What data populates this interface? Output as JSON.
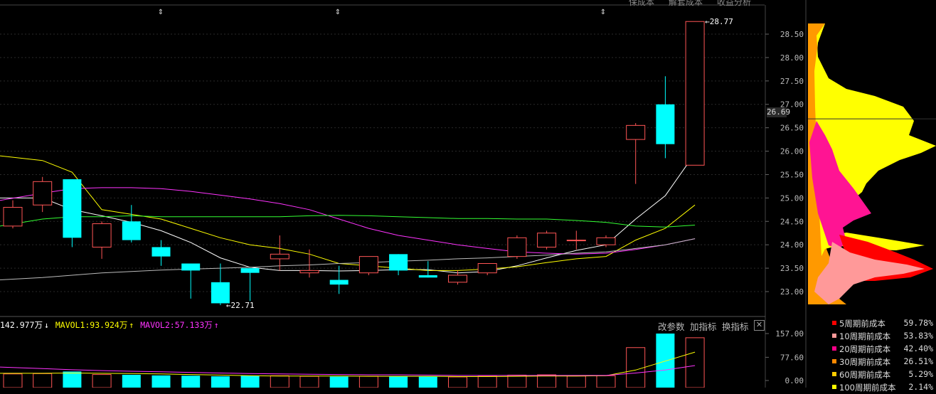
{
  "toolbar": {
    "buttons": [
      "保成本",
      "解套成本",
      "收益分析"
    ]
  },
  "chart_data": [
    {
      "type": "candlestick",
      "price_axis": {
        "ylim": [
          22.71,
          28.77
        ],
        "ticks": [
          "28.50",
          "28.00",
          "27.50",
          "27.00",
          "26.50",
          "26.00",
          "25.50",
          "25.00",
          "24.50",
          "24.00",
          "23.50",
          "23.00"
        ]
      },
      "current_price": "26.69",
      "annotations": {
        "high": "28.77",
        "low": "22.71"
      },
      "candles": [
        {
          "o": 24.4,
          "h": 24.95,
          "l": 24.35,
          "c": 24.8
        },
        {
          "o": 24.85,
          "h": 25.45,
          "l": 24.7,
          "c": 25.35
        },
        {
          "o": 25.4,
          "h": 25.4,
          "l": 23.95,
          "c": 24.15
        },
        {
          "o": 23.95,
          "h": 24.5,
          "l": 23.7,
          "c": 24.45
        },
        {
          "o": 24.5,
          "h": 24.85,
          "l": 24.05,
          "c": 24.1
        },
        {
          "o": 23.95,
          "h": 24.1,
          "l": 23.55,
          "c": 23.75
        },
        {
          "o": 23.6,
          "h": 23.6,
          "l": 22.85,
          "c": 23.45
        },
        {
          "o": 23.2,
          "h": 23.6,
          "l": 22.71,
          "c": 22.75
        },
        {
          "o": 23.5,
          "h": 23.5,
          "l": 22.8,
          "c": 23.4
        },
        {
          "o": 23.7,
          "h": 24.2,
          "l": 23.45,
          "c": 23.8
        },
        {
          "o": 23.4,
          "h": 23.9,
          "l": 23.3,
          "c": 23.45
        },
        {
          "o": 23.25,
          "h": 23.55,
          "l": 22.95,
          "c": 23.15
        },
        {
          "o": 23.4,
          "h": 23.75,
          "l": 23.35,
          "c": 23.75
        },
        {
          "o": 23.8,
          "h": 23.8,
          "l": 23.35,
          "c": 23.45
        },
        {
          "o": 23.35,
          "h": 23.65,
          "l": 23.3,
          "c": 23.3
        },
        {
          "o": 23.2,
          "h": 23.45,
          "l": 23.15,
          "c": 23.35
        },
        {
          "o": 23.4,
          "h": 23.6,
          "l": 23.35,
          "c": 23.6
        },
        {
          "o": 23.75,
          "h": 24.2,
          "l": 23.7,
          "c": 24.15
        },
        {
          "o": 23.95,
          "h": 24.3,
          "l": 23.9,
          "c": 24.25
        },
        {
          "o": 24.1,
          "h": 24.3,
          "l": 23.9,
          "c": 24.1
        },
        {
          "o": 24.0,
          "h": 24.2,
          "l": 23.95,
          "c": 24.15
        },
        {
          "o": 26.25,
          "h": 26.6,
          "l": 25.3,
          "c": 26.55
        },
        {
          "o": 27.0,
          "h": 27.6,
          "l": 25.85,
          "c": 26.15
        },
        {
          "o": 25.7,
          "h": 28.77,
          "l": 25.7,
          "c": 28.77
        }
      ],
      "ma_series": [
        {
          "color": "#ffffff",
          "values": [
            25.0,
            25.0,
            24.75,
            24.62,
            24.48,
            24.3,
            24.05,
            23.72,
            23.52,
            23.45,
            23.45,
            23.44,
            23.45,
            23.47,
            23.47,
            23.4,
            23.43,
            23.55,
            23.72,
            23.88,
            24.0,
            24.55,
            25.05,
            25.95
          ]
        },
        {
          "color": "#ffff00",
          "values": [
            25.9,
            25.8,
            25.55,
            24.75,
            24.65,
            24.55,
            24.35,
            24.15,
            24.0,
            23.92,
            23.8,
            23.6,
            23.55,
            23.5,
            23.45,
            23.45,
            23.48,
            23.53,
            23.62,
            23.7,
            23.75,
            24.1,
            24.35,
            24.85
          ]
        },
        {
          "color": "#ff33ff",
          "values": [
            24.95,
            25.1,
            25.2,
            25.22,
            25.22,
            25.2,
            25.14,
            25.06,
            24.98,
            24.88,
            24.75,
            24.55,
            24.35,
            24.2,
            24.1,
            24.0,
            23.92,
            23.85,
            23.82,
            23.8,
            23.82,
            23.9,
            24.0,
            24.13
          ]
        },
        {
          "color": "#33ff33",
          "values": [
            24.4,
            24.55,
            24.6,
            24.6,
            24.62,
            24.6,
            24.6,
            24.6,
            24.6,
            24.6,
            24.62,
            24.63,
            24.62,
            24.6,
            24.58,
            24.56,
            24.56,
            24.55,
            24.55,
            24.52,
            24.48,
            24.4,
            24.38,
            24.42
          ]
        },
        {
          "color": "#bbbbbb",
          "values": [
            23.25,
            23.3,
            23.35,
            23.4,
            23.43,
            23.46,
            23.48,
            23.5,
            23.52,
            23.55,
            23.57,
            23.6,
            23.62,
            23.65,
            23.67,
            23.7,
            23.72,
            23.75,
            23.78,
            23.82,
            23.85,
            23.92,
            24.0,
            24.13
          ]
        }
      ]
    },
    {
      "type": "bar",
      "title": "volume",
      "legend": {
        "vol": "142.977万",
        "mavol1": "MAVOL1:93.924万",
        "mavol2": "MAVOL2:57.133万"
      },
      "ticks": [
        "157.00",
        "77.60",
        "0.00"
      ],
      "ylim": [
        0,
        157
      ],
      "values": [
        22,
        23,
        30,
        20,
        19,
        17,
        16,
        14,
        16,
        16,
        14,
        13,
        14,
        14,
        13,
        12,
        14,
        18,
        19,
        15,
        16,
        110,
        157,
        143
      ],
      "mavol1": [
        24,
        24,
        25,
        24,
        23,
        22,
        20,
        18,
        16,
        15,
        15,
        15,
        14,
        14,
        14,
        13,
        13,
        14,
        15,
        15,
        16,
        35,
        65,
        95
      ],
      "mavol2": [
        45,
        40,
        36,
        33,
        31,
        29,
        27,
        25,
        23,
        22,
        21,
        20,
        19,
        19,
        18,
        17,
        17,
        17,
        17,
        17,
        17,
        25,
        35,
        50
      ]
    },
    {
      "type": "area",
      "title": "chip distribution",
      "legend": [
        {
          "label": "5周期前成本",
          "value": "59.78%",
          "color": "#ff0000"
        },
        {
          "label": "10周期前成本",
          "value": "53.83%",
          "color": "#ff9999"
        },
        {
          "label": "20周期前成本",
          "value": "42.40%",
          "color": "#ff0088"
        },
        {
          "label": "30周期前成本",
          "value": "26.51%",
          "color": "#ff8800"
        },
        {
          "label": "60周期前成本",
          "value": "5.29%",
          "color": "#ffcc00"
        },
        {
          "label": "100周期前成本",
          "value": "2.14%",
          "color": "#ffff00"
        }
      ]
    }
  ]
}
